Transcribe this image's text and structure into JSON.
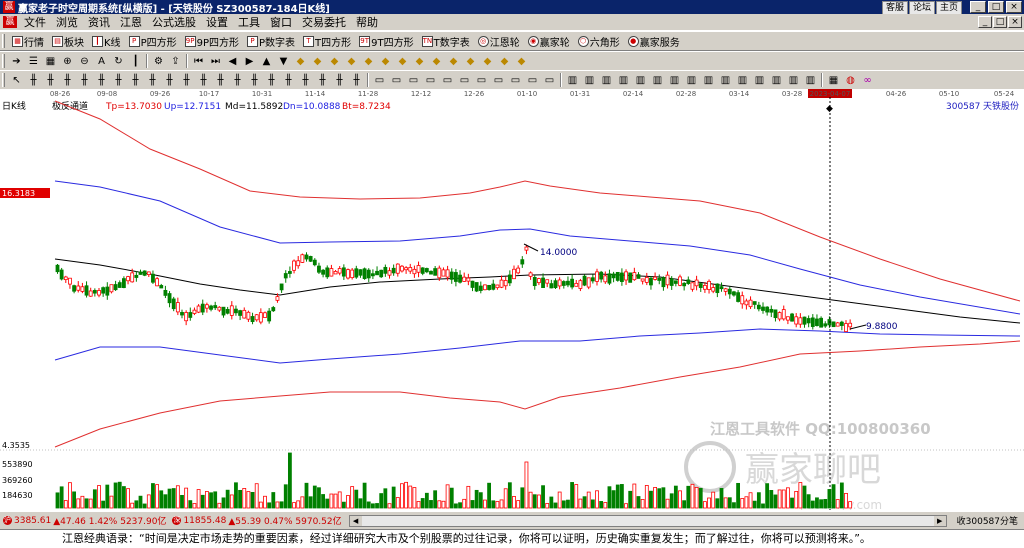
{
  "titlebar": {
    "app_icon": "赢",
    "title": "赢家老子时空周期系统[纵横版] - [天铁股份   SZ300587-184日K线]",
    "links": [
      "客服",
      "论坛",
      "主页"
    ],
    "buttons": [
      "_",
      "□",
      "×"
    ]
  },
  "menubar": {
    "items": [
      "文件",
      "浏览",
      "资讯",
      "江恩",
      "公式选股",
      "设置",
      "工具",
      "窗口",
      "交易委托",
      "帮助"
    ],
    "mdi_buttons": [
      "_",
      "□",
      "×"
    ]
  },
  "toolbar1": {
    "buttons": [
      {
        "label": "行情",
        "icon": "grid-icon"
      },
      {
        "label": "板块",
        "icon": "sector-icon"
      },
      {
        "label": "K线",
        "icon": "kline-icon"
      },
      {
        "label": "P四方形",
        "icon": "P"
      },
      {
        "label": "9P四方形",
        "icon": "9P"
      },
      {
        "label": "P数字表",
        "icon": "P"
      },
      {
        "label": "T四方形",
        "icon": "T"
      },
      {
        "label": "9T四方形",
        "icon": "9T"
      },
      {
        "label": "T数字表",
        "icon": "TN"
      },
      {
        "label": "江恩轮",
        "icon": "wheel-icon"
      },
      {
        "label": "赢家轮",
        "icon": "wheel-icon"
      },
      {
        "label": "六角形",
        "icon": "hexagon-icon"
      },
      {
        "label": "赢家服务",
        "icon": "service-icon"
      }
    ]
  },
  "chart": {
    "period_label": "日K线",
    "indicator_name": "极反通道",
    "tp": "Tp=13.7030",
    "up": "Up=12.7151",
    "md": "Md=11.5892",
    "dn": "Dn=10.0888",
    "bt": "Bt=8.7234",
    "stock_code": "300587",
    "stock_name": "天铁股份",
    "price_marker": "16.3183",
    "high_annotation": "14.0000",
    "low_annotation": "9.8800",
    "cursor_date": "2023-04-07",
    "date_ticks": [
      "08-26",
      "09-08",
      "09-26",
      "10-17",
      "10-31",
      "11-14",
      "11-28",
      "12-12",
      "12-26",
      "01-10",
      "01-31",
      "02-14",
      "02-28",
      "03-14",
      "03-28",
      "04-26",
      "05-10",
      "05-24"
    ],
    "volume_axis": [
      "553890",
      "369260",
      "184630"
    ],
    "price_low_label": "4.3535",
    "watermark_text": "江恩工具软件  QQ:100800360",
    "watermark_brand": "赢家聊吧",
    "watermark_url": "jiaoba.yy.com"
  },
  "statusbar": {
    "idx1_value": "3385.61",
    "idx1_change": "▲47.46 1.42% 5237.90亿",
    "idx2_value": "11855.48",
    "idx2_change": "▲55.39 0.47% 5970.52亿",
    "right_text": "收300587分笔"
  },
  "quotebar": {
    "text": "江恩经典语录：“时间是决定市场走势的重要因素，经过详细研究大市及个别股票的过往记录，你将可以证明，历史确实重复发生；而了解过往，你将可以预测将来。”。"
  },
  "colors": {
    "titlebar": "#0a246a",
    "toolbar": "#d4d0c8",
    "up_candle": "#ff0000",
    "down_candle": "#008000",
    "tp_line": "#e00000",
    "up_line": "#2020e0",
    "md_line": "#000000"
  },
  "chart_data": {
    "type": "candlestick",
    "title": "天铁股份 300587 日K线 - 极反通道",
    "ylim": [
      4.35,
      16.32
    ],
    "channel_lines": {
      "Tp": 13.703,
      "Up": 12.7151,
      "Md": 11.5892,
      "Dn": 10.0888,
      "Bt": 8.7234
    },
    "annotations": [
      {
        "label": "14.0000",
        "x": "2023-01-10"
      },
      {
        "label": "9.8800",
        "x": "2023-04-07"
      }
    ],
    "volume_ticks": [
      184630,
      369260,
      553890
    ]
  }
}
